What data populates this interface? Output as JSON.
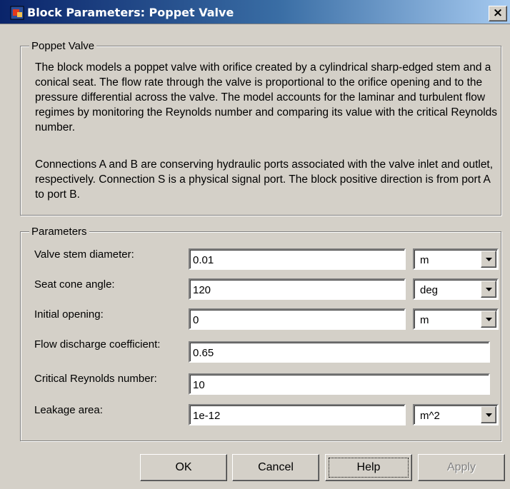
{
  "window": {
    "title": "Block Parameters: Poppet Valve",
    "close_glyph": "×"
  },
  "description_group": {
    "title": "Poppet Valve",
    "paragraphs": [
      "The block models a poppet valve with orifice created by a cylindrical sharp-edged stem and a conical seat. The flow rate through the valve is proportional to the orifice opening and to the pressure differential across the valve. The model accounts for the laminar and turbulent flow regimes by monitoring the Reynolds number and comparing its value with the critical Reynolds number.",
      "Connections A and B are conserving hydraulic ports associated with the valve inlet and outlet, respectively. Connection S is a physical signal port. The block positive direction is from port A to port B."
    ]
  },
  "parameters_group": {
    "title": "Parameters",
    "rows": [
      {
        "label": "Valve stem diameter:",
        "value": "0.01",
        "unit": "m"
      },
      {
        "label": "Seat cone angle:",
        "value": "120",
        "unit": "deg"
      },
      {
        "label": "Initial opening:",
        "value": "0",
        "unit": "m"
      },
      {
        "label": "Flow discharge coefficient:",
        "value": "0.65"
      },
      {
        "label": "Critical Reynolds number:",
        "value": "10"
      },
      {
        "label": "Leakage area:",
        "value": "1e-12",
        "unit": "m^2"
      }
    ]
  },
  "buttons": {
    "ok": "OK",
    "cancel": "Cancel",
    "help": "Help",
    "apply": "Apply"
  },
  "icons": {
    "title": "simulink-block-icon",
    "dropdown": "chevron-down-icon"
  }
}
